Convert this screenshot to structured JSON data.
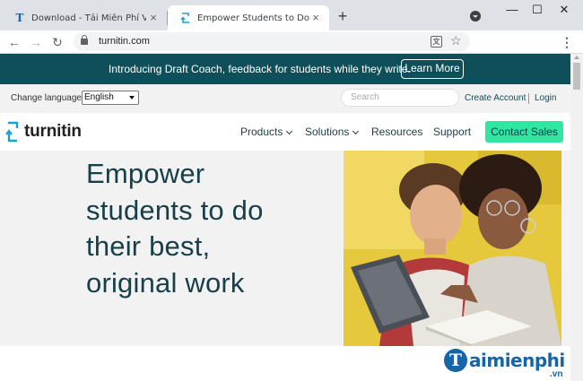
{
  "browser": {
    "tabs": [
      {
        "title": "Download - Tải Miễn Phí VN - Ph",
        "active": false,
        "favicon": "taimienphi-favicon",
        "favicon_letter": "T",
        "favicon_color": "#1565c0"
      },
      {
        "title": "Empower Students to Do Their Be",
        "active": true,
        "favicon": "turnitin-favicon",
        "favicon_color": "#1a9fd8"
      }
    ],
    "close_glyph": "×",
    "new_tab_glyph": "+",
    "window_controls": {
      "minimize": "—",
      "maximize": "☐",
      "close": "✕"
    },
    "nav": {
      "back": "←",
      "forward": "→",
      "reload": "↻"
    },
    "url": "turnitin.com",
    "translate_glyph": "文",
    "star_glyph": "☆",
    "menu_glyph": "⋮"
  },
  "announcement": {
    "text": "Introducing Draft Coach, feedback for students while they write.",
    "button": "Learn More"
  },
  "utility": {
    "change_language_label": "Change language",
    "language_selected": "English",
    "search_placeholder": "Search",
    "create_account": "Create Account",
    "login": "Login"
  },
  "nav": {
    "logo_text": "turnitin",
    "items": [
      {
        "label": "Products",
        "has_dropdown": true
      },
      {
        "label": "Solutions",
        "has_dropdown": true
      },
      {
        "label": "Resources",
        "has_dropdown": false
      },
      {
        "label": "Support",
        "has_dropdown": false
      }
    ],
    "cta": "Contact Sales"
  },
  "hero": {
    "headline_lines": [
      "Empower",
      "students to do",
      "their best,",
      "original work"
    ]
  },
  "watermark": {
    "letter": "T",
    "text": "aimienphi",
    "suffix": ".vn"
  },
  "colors": {
    "brand_teal": "#0e4f5a",
    "cta_green": "#2ee8a2",
    "headline": "#163f4a",
    "logo_blue": "#1a9fd8"
  }
}
